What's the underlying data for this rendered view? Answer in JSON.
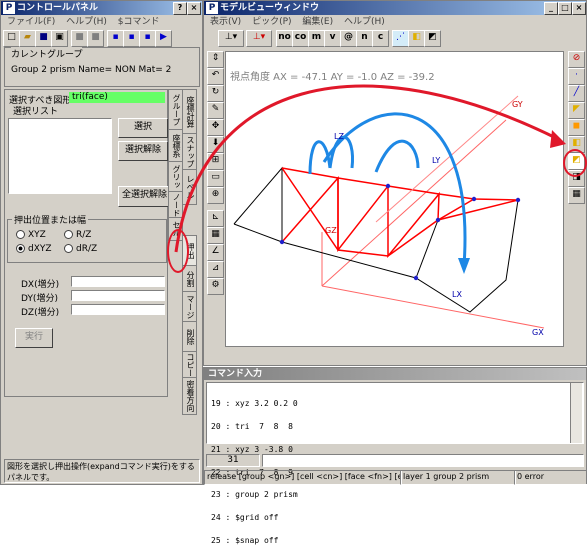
{
  "control_panel": {
    "title": "コントロールパネル",
    "menu": [
      "ファイル(F)",
      "ヘルプ(H)",
      "$コマンド"
    ],
    "current_group_label": "カレントグループ",
    "current_group_value": "Group 2 prism Name= NON Mat= 2",
    "select_shape_label": "選択すべき図形",
    "select_shape_value": "tri(face)",
    "select_list_label": "選択リスト",
    "select_button": "選択",
    "deselect_button": "選択解除",
    "deselect_all_button": "全選択解除",
    "extrude_group_label": "押出位置または幅",
    "radios": [
      "XYZ",
      "R/Z",
      "dXYZ",
      "dR/Z"
    ],
    "selected_radio": "dXYZ",
    "fields": [
      {
        "label": "DX(増分)",
        "value": ""
      },
      {
        "label": "DY(増分)",
        "value": ""
      },
      {
        "label": "DZ(増分)",
        "value": ""
      }
    ],
    "execute_button": "実行",
    "tabs_left": [
      "グループ",
      "座標系",
      "グリッド",
      "ノード",
      "セル"
    ],
    "tabs_right": [
      "座標計算",
      "スナップ",
      "レベル",
      "押出",
      "分割",
      "マージ",
      "削除",
      "コピー",
      "密着方向"
    ],
    "status_text": "図形を選択し押出操作(expandコマンド実行)をするパネルです。"
  },
  "model_view": {
    "title": "モデルビューウィンドウ",
    "menu": [
      "表示(V)",
      "ピック(P)",
      "編集(E)",
      "ヘルプ(H)"
    ],
    "toolbar_text_buttons": [
      "no",
      "co",
      "m",
      "v",
      "@",
      "n",
      "c"
    ],
    "view_angle_text": "視点角度 AX = -47.1  AY = -1.0  AZ = -39.2",
    "axis_labels": [
      "GZ",
      "GX",
      "LX",
      "LZ",
      "LY",
      "GY"
    ],
    "tools_left": [
      "axis-rotate",
      "rotate",
      "rotate-z",
      "pen",
      "pan",
      "move-down",
      "zoom",
      "zoom-box",
      "measure",
      "grid",
      "angle",
      "node",
      "settings"
    ],
    "tools_right": [
      "no-entry",
      "blue-node",
      "blue-edge",
      "yellow-face",
      "orange-face",
      "yellow-cube",
      "selected-cube",
      "dark-cube",
      "grid-cube"
    ]
  },
  "command_panel": {
    "title": "コマンド入力",
    "lines": [
      "19 : xyz 3.2 0.2 0",
      "20 : tri  7  8  8",
      "21 : xyz 3 -3.8 0",
      "22 : tri  7  8  9",
      "23 : group 2 prism",
      "24 : $grid off",
      "25 : $snap off"
    ],
    "line_number": "31",
    "input_value": ""
  },
  "status_bar": {
    "hint": "release [group <gn>] [cell <cn>] [face <fn>] [edge <en>] [node <nn>]",
    "layer": "layer 1 group 2 prism",
    "error": "0 error"
  },
  "colors": {
    "title_active": "#0a246a",
    "annotation_red": "#e0182a",
    "arrow_blue": "#1e88e5",
    "selected_green": "#66ff66",
    "model_red": "#ff0000",
    "node_blue": "#2020cc"
  }
}
